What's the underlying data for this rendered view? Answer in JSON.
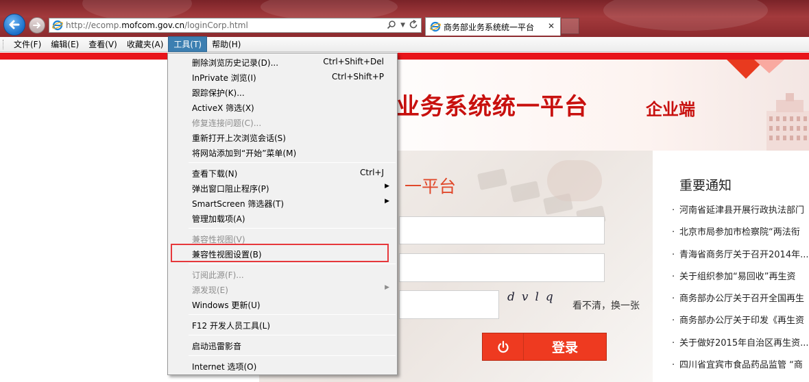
{
  "browser": {
    "address": {
      "url_prefix": "http://ecomp.",
      "url_domain": "mofcom.gov.cn",
      "url_suffix": "/loginCorp.html",
      "search_icon": "search-icon",
      "refresh_icon": "refresh-icon"
    },
    "tab": {
      "title": "商务部业务系统统一平台",
      "close": "✕"
    },
    "menubar": [
      {
        "label": "文件(F)"
      },
      {
        "label": "编辑(E)"
      },
      {
        "label": "查看(V)"
      },
      {
        "label": "收藏夹(A)"
      },
      {
        "label": "工具(T)",
        "active": true
      },
      {
        "label": "帮助(H)"
      }
    ]
  },
  "tools_menu": {
    "items": [
      {
        "label": "删除浏览历史记录(D)...",
        "shortcut": "Ctrl+Shift+Del",
        "enabled": true
      },
      {
        "label": "InPrivate 浏览(I)",
        "shortcut": "Ctrl+Shift+P",
        "enabled": true
      },
      {
        "label": "跟踪保护(K)...",
        "shortcut": "",
        "enabled": true
      },
      {
        "label": "ActiveX 筛选(X)",
        "shortcut": "",
        "enabled": true
      },
      {
        "label": "修复连接问题(C)...",
        "shortcut": "",
        "enabled": false
      },
      {
        "label": "重新打开上次浏览会话(S)",
        "shortcut": "",
        "enabled": true
      },
      {
        "label": "将网站添加到“开始”菜单(M)",
        "shortcut": "",
        "enabled": true
      },
      {
        "label": "查看下载(N)",
        "shortcut": "Ctrl+J",
        "enabled": true
      },
      {
        "label": "弹出窗口阻止程序(P)",
        "shortcut": "",
        "enabled": true,
        "submenu": true
      },
      {
        "label": "SmartScreen 筛选器(T)",
        "shortcut": "",
        "enabled": true,
        "submenu": true
      },
      {
        "label": "管理加载项(A)",
        "shortcut": "",
        "enabled": true
      },
      {
        "label": "兼容性视图(V)",
        "shortcut": "",
        "enabled": false
      },
      {
        "label": "兼容性视图设置(B)",
        "shortcut": "",
        "enabled": true,
        "highlighted": true
      },
      {
        "label": "订阅此源(F)...",
        "shortcut": "",
        "enabled": false
      },
      {
        "label": "源发现(E)",
        "shortcut": "",
        "enabled": false,
        "submenu": true
      },
      {
        "label": "Windows 更新(U)",
        "shortcut": "",
        "enabled": true
      },
      {
        "label": "F12 开发人员工具(L)",
        "shortcut": "",
        "enabled": true
      },
      {
        "label": "启动迅雷影音",
        "shortcut": "",
        "enabled": true
      },
      {
        "label": "Internet 选项(O)",
        "shortcut": "",
        "enabled": true
      }
    ],
    "submenu_arrow": "▶"
  },
  "page": {
    "title": "业务系统统一平台",
    "subtitle": "企业端",
    "login": {
      "heading": "一平台",
      "captcha_code": "dvlq",
      "captcha_refresh": "看不清，换一张",
      "button_label": "登录",
      "power_icon": "power-icon"
    },
    "notices": {
      "title": "重要通知",
      "items": [
        "河南省延津县开展行政执法部门",
        "北京市局参加市检察院“两法衔",
        "青海省商务厅关于召开2014年...",
        "关于组织参加“易回收”再生资",
        "商务部办公厅关于召开全国再生",
        "商务部办公厅关于印发《再生资",
        "关于做好2015年自治区再生资...",
        "四川省宜宾市食品药品监管 “商"
      ]
    }
  },
  "colors": {
    "brand_red": "#c8100e",
    "accent_red": "#ee3a20",
    "highlight_border": "#e6373b",
    "menu_active": "#3c7fb1"
  }
}
